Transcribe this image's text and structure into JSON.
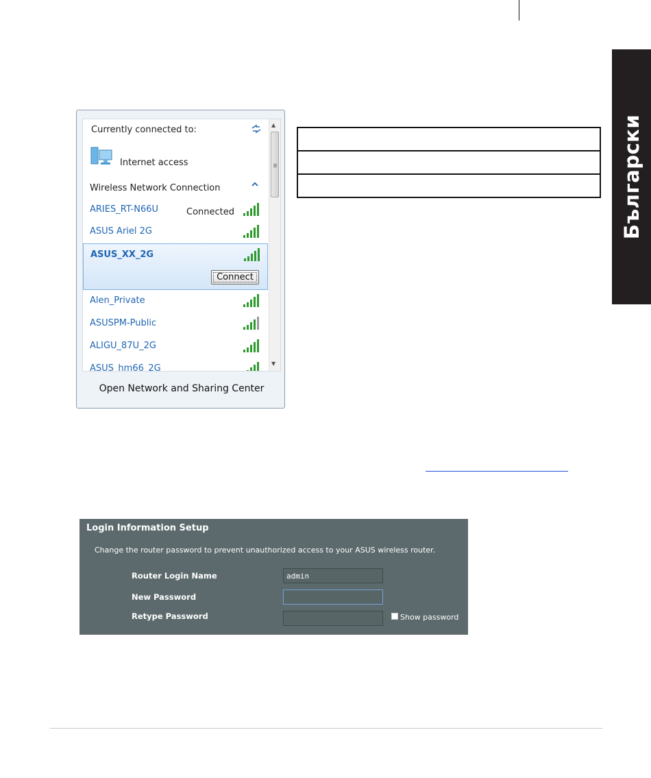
{
  "side_tab": {
    "label": "Български"
  },
  "network_popup": {
    "connected_heading": "Currently connected to:",
    "internet_access": "Internet access",
    "section_title": "Wireless Network Connection",
    "networks": [
      {
        "name": "ARIES_RT-N66U",
        "status": "Connected"
      },
      {
        "name": "ASUS Ariel 2G"
      },
      {
        "name": "ASUS_XX_2G",
        "button": "Connect"
      },
      {
        "name": "Alen_Private"
      },
      {
        "name": "ASUSPM-Public"
      },
      {
        "name": "ALIGU_87U_2G"
      },
      {
        "name": "ASUS_hm66_2G"
      }
    ],
    "footer_link": "Open Network and Sharing Center"
  },
  "login_setup": {
    "title": "Login Information  Setup",
    "description": "Change the router password to prevent unauthorized access to your ASUS wireless router.",
    "fields": {
      "login_name_label": "Router Login Name",
      "login_name_value": "admin",
      "new_password_label": "New Password",
      "new_password_value": "",
      "retype_password_label": "Retype Password",
      "retype_password_value": ""
    },
    "show_password": "Show password"
  },
  "colors": {
    "link_blue": "#1f65b3",
    "signal_green": "#2e9a2e",
    "panel_bg": "#5c6a6d",
    "tab_bg": "#231f20"
  }
}
